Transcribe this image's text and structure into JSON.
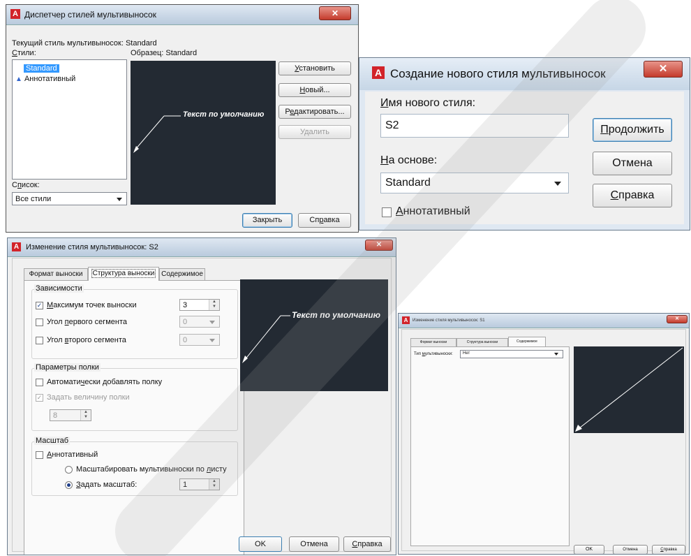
{
  "manager": {
    "title": "Диспетчер стилей мультивыносок",
    "current_style_label": "Текущий стиль мультивыносок: Standard",
    "styles_label": "Стили:",
    "preview_label": "Образец: Standard",
    "styles": [
      {
        "name": "Standard",
        "selected": true,
        "icon": ""
      },
      {
        "name": "Аннотативный",
        "selected": false,
        "icon": "annotative-icon"
      }
    ],
    "preview_text": "Текст по умолчанию",
    "list_label": "Список:",
    "list_value": "Все стили",
    "buttons": {
      "set_current": "Установить",
      "new": "Новый...",
      "modify": "Редактировать...",
      "delete": "Удалить",
      "close": "Закрыть",
      "help": "Справка"
    }
  },
  "create": {
    "title": "Создание нового стиля мультивыносок",
    "name_label": "Имя нового стиля:",
    "name_value": "S2",
    "based_on_label": "На основе:",
    "based_on_value": "Standard",
    "annotative_label": "Аннотативный",
    "buttons": {
      "continue": "Продолжить",
      "cancel": "Отмена",
      "help": "Справка"
    }
  },
  "modify": {
    "title": "Изменение стиля мультивыносок: S2",
    "tabs": [
      "Формат выноски",
      "Структура выноски",
      "Содержимое"
    ],
    "active_tab": 1,
    "constraints": {
      "label": "Зависимости",
      "max_points_label": "Максимум точек выноски",
      "max_points_checked": true,
      "max_points_value": "3",
      "first_angle_label": "Угол первого сегмента",
      "first_angle_value": "0",
      "second_angle_label": "Угол второго сегмента",
      "second_angle_value": "0"
    },
    "landing": {
      "label": "Параметры полки",
      "auto_label": "Автоматически добавлять полку",
      "set_distance_label": "Задать величину полки",
      "distance_value": "8"
    },
    "scale": {
      "label": "Масштаб",
      "annotative_label": "Аннотативный",
      "scale_to_layout_label": "Масштабировать мультивыноски по листу",
      "specify_scale_label": "Задать масштаб:",
      "scale_value": "1"
    },
    "preview_text": "Текст по умолчанию",
    "buttons": {
      "ok": "OK",
      "cancel": "Отмена",
      "help": "Справка"
    }
  },
  "modify_small": {
    "title": "Изменение стиля мультивыносок: S1",
    "tabs": [
      "Формат выноски",
      "Структура выноски",
      "Содержимое"
    ],
    "active_tab": 2,
    "type_label": "Тип мультивыноски:",
    "type_value": "Нет",
    "buttons": {
      "ok": "OK",
      "cancel": "Отмена",
      "help": "Справка"
    }
  },
  "colors": {
    "preview_bg": "#232a33",
    "logo_red": "#d2232a",
    "close_red": "#c43b2c",
    "selection_blue": "#3399ff"
  }
}
